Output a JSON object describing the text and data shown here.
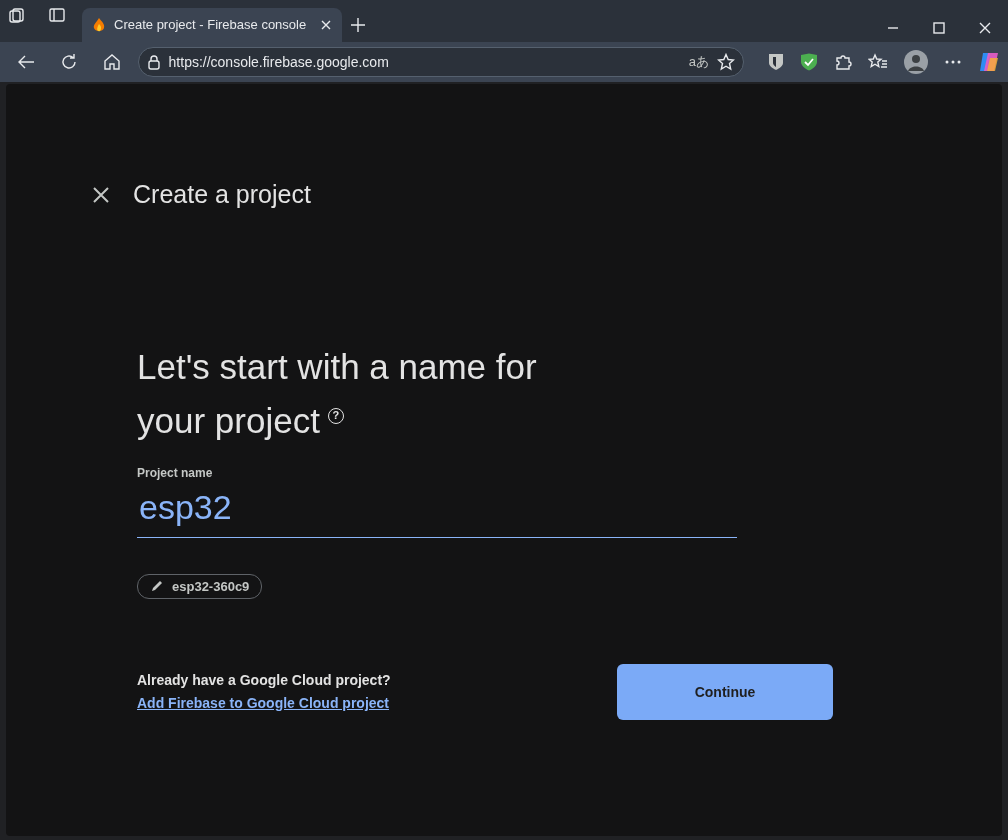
{
  "browser": {
    "tab": {
      "title": "Create project - Firebase console",
      "selected": true
    },
    "url": "https://console.firebase.google.com",
    "translate_glyph": "aあ"
  },
  "page": {
    "title": "Create a project",
    "heading": [
      "Let's start with a name for",
      "your project"
    ],
    "help_glyph": "?",
    "field": {
      "label": "Project name",
      "value": "esp32"
    },
    "project_id_chip": "esp32-360c9",
    "cloud_prompt": "Already have a Google Cloud project?",
    "cloud_link": "Add Firebase to Google Cloud project",
    "continue_button": "Continue"
  }
}
